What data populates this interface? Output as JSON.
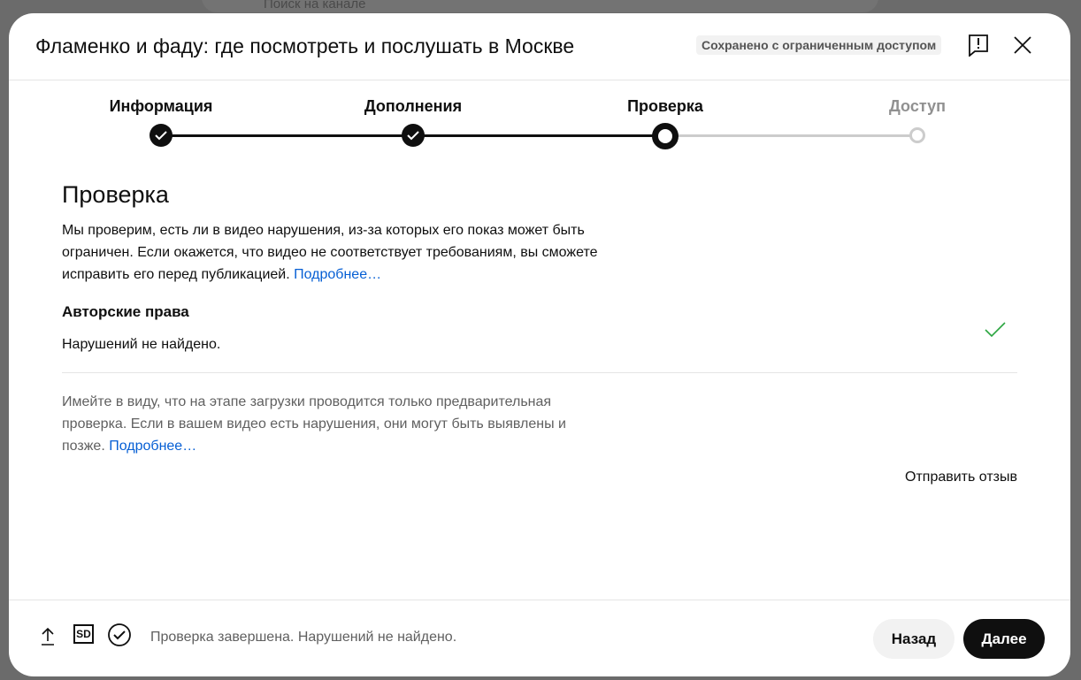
{
  "background": {
    "search_placeholder": "Поиск на канале"
  },
  "header": {
    "title": "Фламенко и фаду: где посмотреть и послушать в Москве",
    "badge": "Сохранено с ограниченным доступом"
  },
  "steps": [
    {
      "label": "Информация",
      "state": "done"
    },
    {
      "label": "Дополнения",
      "state": "done"
    },
    {
      "label": "Проверка",
      "state": "current"
    },
    {
      "label": "Доступ",
      "state": "upcoming"
    }
  ],
  "main": {
    "heading": "Проверка",
    "description": "Мы проверим, есть ли в видео нарушения, из-за которых его показ может быть ограничен. Если окажется, что видео не соответствует требованиям, вы сможете исправить его перед публикацией.",
    "learn_more": "Подробнее…",
    "copyright": {
      "title": "Авторские права",
      "result": "Нарушений не найдено."
    },
    "note": "Имейте в виду, что на этапе загрузки проводится только предварительная проверка. Если в вашем видео есть нарушения, они могут быть выявлены и позже.",
    "note_link": "Подробнее…",
    "feedback": "Отправить отзыв"
  },
  "footer": {
    "sd_label": "SD",
    "status": "Проверка завершена. Нарушений не найдено.",
    "back": "Назад",
    "next": "Далее"
  },
  "colors": {
    "accent": "#065fd4",
    "success": "#2ba640"
  }
}
